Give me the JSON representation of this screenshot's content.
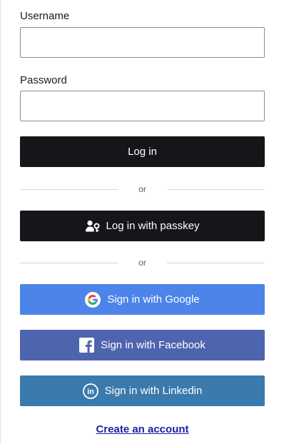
{
  "username": {
    "label": "Username",
    "value": "",
    "placeholder": ""
  },
  "password": {
    "label": "Password",
    "value": "",
    "placeholder": ""
  },
  "login_button": "Log in",
  "divider_1": "or",
  "passkey_button": {
    "label": "Log in with passkey",
    "icon": "passkey-icon"
  },
  "divider_2": "or",
  "social": {
    "google": {
      "label": "Sign in with Google",
      "icon": "google-icon",
      "color": "#4c84ea"
    },
    "facebook": {
      "label": "Sign in with Facebook",
      "icon": "facebook-icon",
      "color": "#4d64ae"
    },
    "linkedin": {
      "label": "Sign in with Linkedin",
      "icon": "linkedin-icon",
      "color": "#3a7aad"
    }
  },
  "create_account": "Create an account",
  "colors": {
    "dark_button": "#15151a",
    "link": "#1a21a6"
  }
}
